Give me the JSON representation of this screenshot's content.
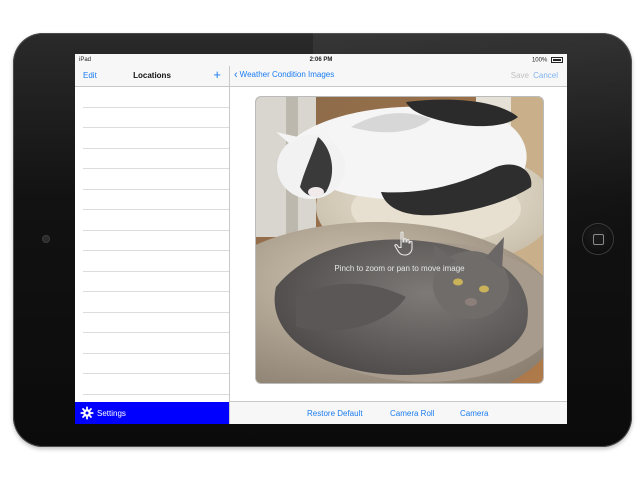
{
  "status_bar": {
    "carrier": "iPad",
    "time": "2:06 PM",
    "battery": "100%"
  },
  "master": {
    "edit_label": "Edit",
    "title": "Locations",
    "add_icon": "plus-icon",
    "settings_label": "Settings",
    "settings_icon": "gear-icon",
    "settings_color": "#0000ff"
  },
  "detail": {
    "back_label": "Weather Condition Images",
    "save_label": "Save",
    "cancel_label": "Cancel",
    "image_hint": "Pinch to zoom or pan to move image",
    "hint_icon": "hand-pointer-icon"
  },
  "toolbar": {
    "restore_label": "Restore Default",
    "camera_roll_label": "Camera Roll",
    "camera_label": "Camera"
  },
  "colors": {
    "accent": "#1a7cf0",
    "settings_bar": "#0000ff"
  }
}
